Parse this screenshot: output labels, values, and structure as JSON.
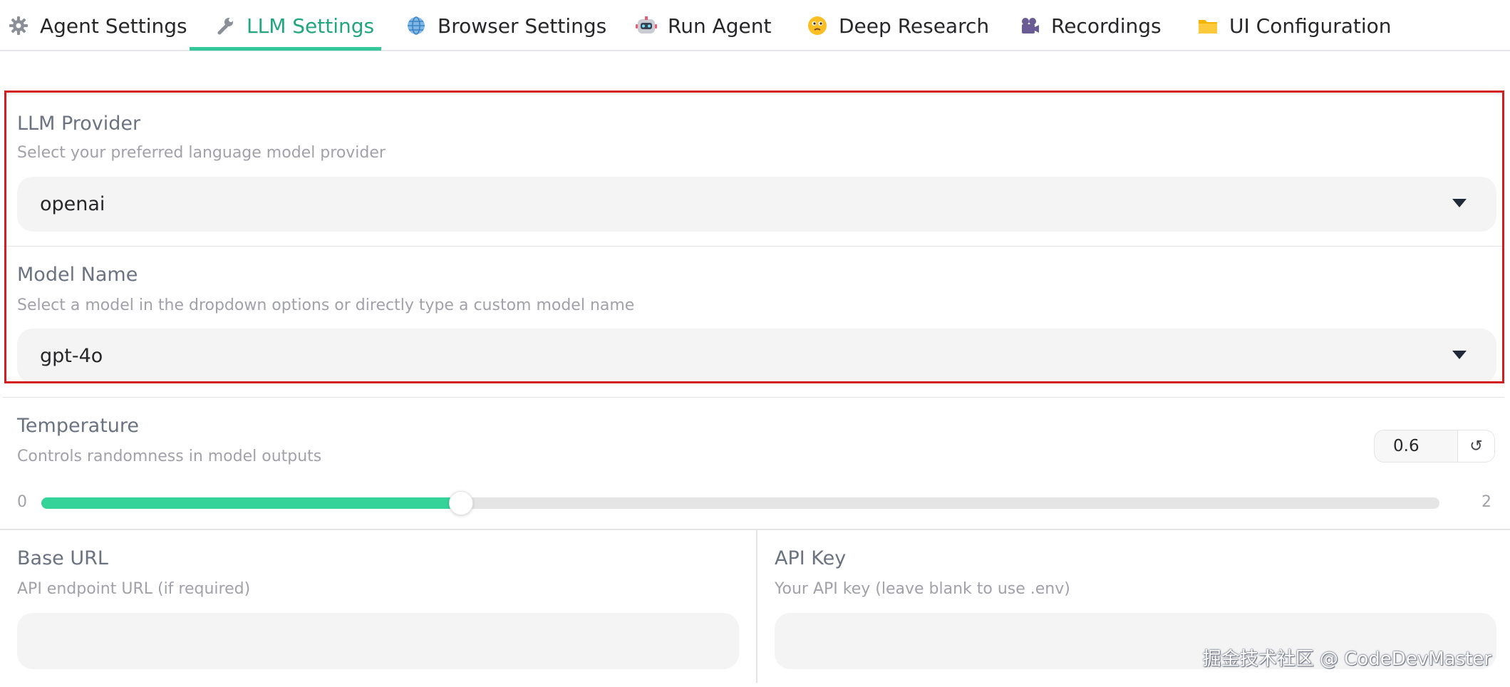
{
  "tabs": [
    {
      "label": "Agent Settings",
      "icon": "gear-icon"
    },
    {
      "label": "LLM Settings",
      "icon": "wrench-icon"
    },
    {
      "label": "Browser Settings",
      "icon": "globe-icon"
    },
    {
      "label": "Run Agent",
      "icon": "robot-icon"
    },
    {
      "label": "Deep Research",
      "icon": "thinking-face-icon"
    },
    {
      "label": "Recordings",
      "icon": "video-camera-icon"
    },
    {
      "label": "UI Configuration",
      "icon": "folder-icon"
    }
  ],
  "active_tab": "LLM Settings",
  "llm_provider": {
    "label": "LLM Provider",
    "info": "Select your preferred language model provider",
    "value": "openai"
  },
  "model_name": {
    "label": "Model Name",
    "info": "Select a model in the dropdown options or directly type a custom model name",
    "value": "gpt-4o"
  },
  "temperature": {
    "label": "Temperature",
    "info": "Controls randomness in model outputs",
    "value": "0.6",
    "min": "0",
    "max": "2",
    "fraction": 0.3,
    "reset_symbol": "↺"
  },
  "base_url": {
    "label": "Base URL",
    "info": "API endpoint URL (if required)",
    "value": ""
  },
  "api_key": {
    "label": "API Key",
    "info": "Your API key (leave blank to use .env)",
    "value": ""
  },
  "watermark": "掘金技术社区 @ CodeDevMaster",
  "colors": {
    "accent": "#22a67f",
    "slider_fill": "#34d399",
    "highlight_border": "#d21e1e"
  }
}
